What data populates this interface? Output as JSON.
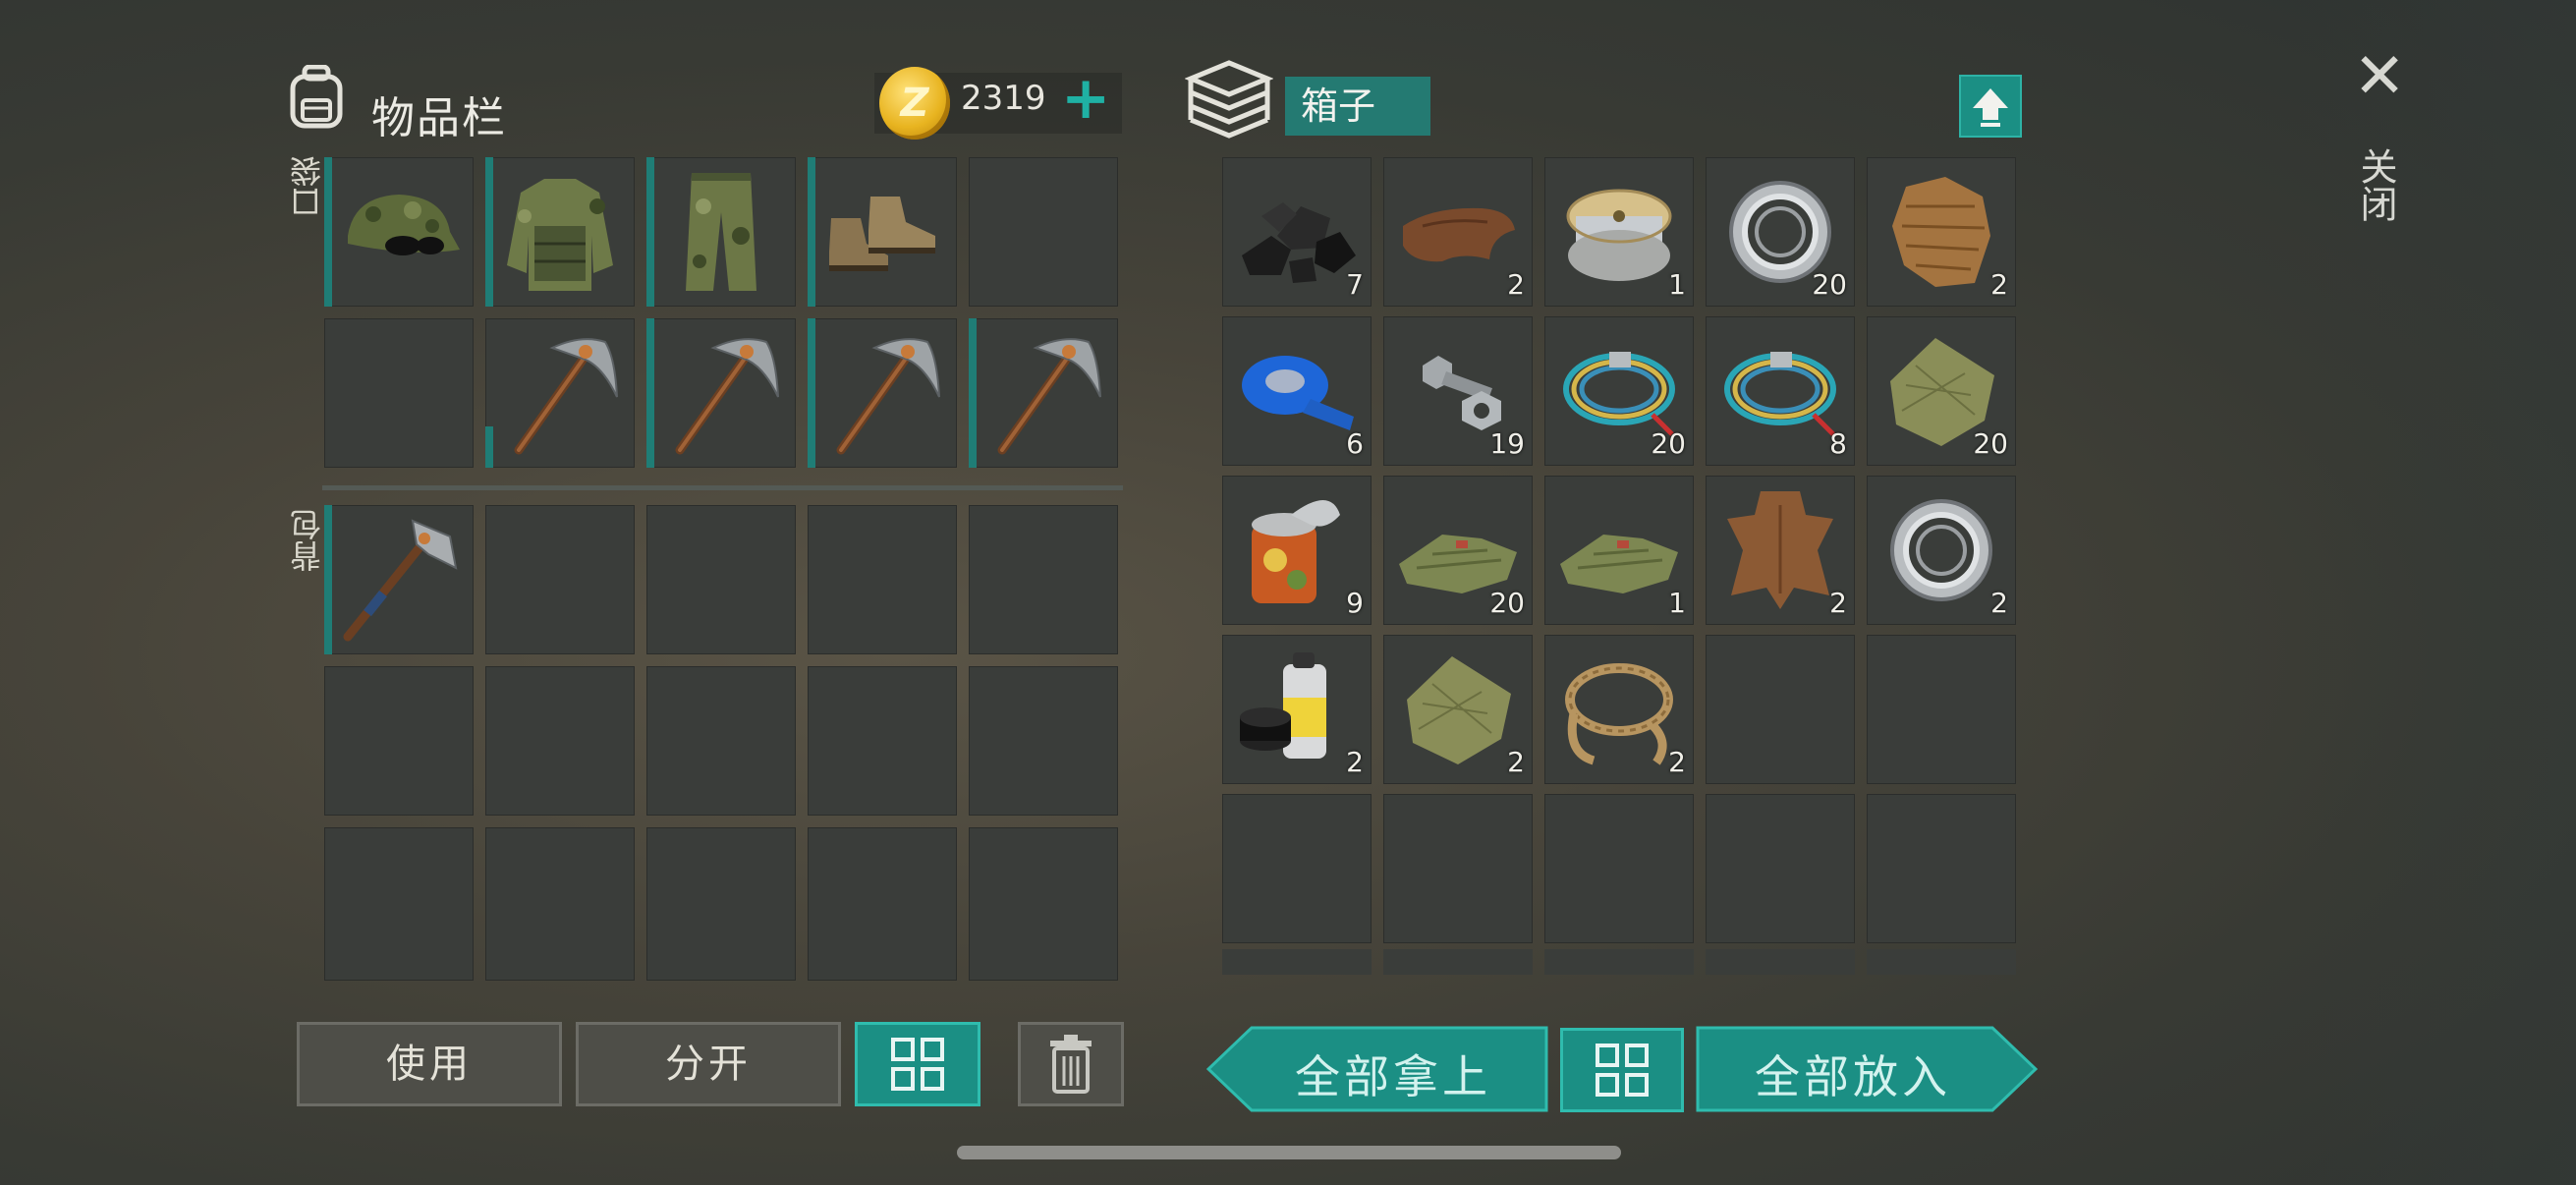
{
  "inventory": {
    "title": "物品栏",
    "coins": "2319",
    "coin_letter": "Z",
    "pockets_label": "口袋",
    "backpack_label": "背包",
    "pockets": [
      {
        "icon": "camo-cap-icon",
        "qty": ""
      },
      {
        "icon": "camo-vest-icon",
        "qty": ""
      },
      {
        "icon": "camo-pants-icon",
        "qty": ""
      },
      {
        "icon": "boots-icon",
        "qty": ""
      },
      {
        "icon": "",
        "qty": ""
      },
      {
        "icon": "",
        "qty": ""
      },
      {
        "icon": "pickaxe-icon",
        "qty": ""
      },
      {
        "icon": "pickaxe-icon",
        "qty": ""
      },
      {
        "icon": "pickaxe-icon",
        "qty": ""
      },
      {
        "icon": "pickaxe-icon",
        "qty": ""
      }
    ],
    "backpack": [
      {
        "icon": "hatchet-icon",
        "qty": ""
      }
    ]
  },
  "box": {
    "label": "箱子",
    "items": [
      {
        "icon": "coal-icon",
        "qty": "7"
      },
      {
        "icon": "leather-icon",
        "qty": "2"
      },
      {
        "icon": "wire-spool-icon",
        "qty": "1"
      },
      {
        "icon": "bearing-icon",
        "qty": "20"
      },
      {
        "icon": "fur-icon",
        "qty": "2"
      },
      {
        "icon": "blue-tape-icon",
        "qty": "6"
      },
      {
        "icon": "bolt-nut-icon",
        "qty": "19"
      },
      {
        "icon": "wire-coil-icon",
        "qty": "20"
      },
      {
        "icon": "wire-coil-icon",
        "qty": "8"
      },
      {
        "icon": "cloth-icon",
        "qty": "20"
      },
      {
        "icon": "tin-can-icon",
        "qty": "9"
      },
      {
        "icon": "green-cloth-icon",
        "qty": "20"
      },
      {
        "icon": "green-cloth-icon",
        "qty": "1"
      },
      {
        "icon": "hide-icon",
        "qty": "2"
      },
      {
        "icon": "bearing-icon",
        "qty": "2"
      },
      {
        "icon": "spray-paint-icon",
        "qty": "2"
      },
      {
        "icon": "cloth-icon",
        "qty": "2"
      },
      {
        "icon": "rope-icon",
        "qty": "2"
      }
    ]
  },
  "buttons": {
    "use": "使用",
    "split": "分开",
    "take_all": "全部拿上",
    "put_all": "全部放入"
  },
  "close_label": "关闭",
  "colors": {
    "accent": "#1b8f84",
    "accent_border": "#2fbcae",
    "slot": "#3a3d3a"
  }
}
